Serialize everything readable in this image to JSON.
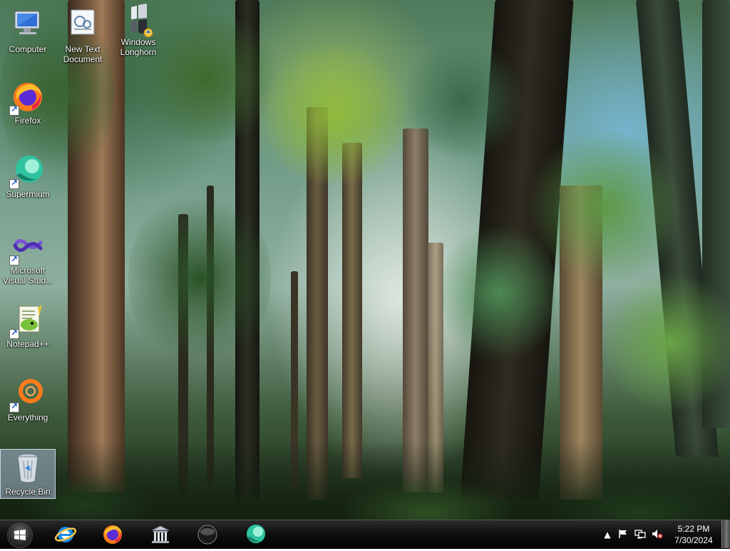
{
  "desktop": {
    "icons": [
      {
        "label": "Computer"
      },
      {
        "label": "New Text Document"
      },
      {
        "label": "Windows Longhorn"
      },
      {
        "label": "Firefox"
      },
      {
        "label": "Supermium"
      },
      {
        "label": "Microsoft Visual Stud..."
      },
      {
        "label": "Notepad++"
      },
      {
        "label": "Everything"
      },
      {
        "label": "Recycle Bin"
      }
    ]
  },
  "taskbar": {
    "pinned": [
      {
        "name": "internet-explorer-icon"
      },
      {
        "name": "firefox-icon"
      },
      {
        "name": "library-icon"
      },
      {
        "name": "dark-orb-icon"
      },
      {
        "name": "supermium-icon"
      }
    ],
    "tray": {
      "icons": [
        "show-hidden-icons-arrow",
        "action-center-flag-icon",
        "network-icon",
        "volume-muted-icon"
      ]
    },
    "clock": {
      "time": "5:22 PM",
      "date": "7/30/2024"
    }
  },
  "colors": {
    "taskbar": "#000000",
    "selection": "#aabed7",
    "firefox_orange": "#ff7a1a",
    "supermium_teal": "#2fc3a0"
  }
}
